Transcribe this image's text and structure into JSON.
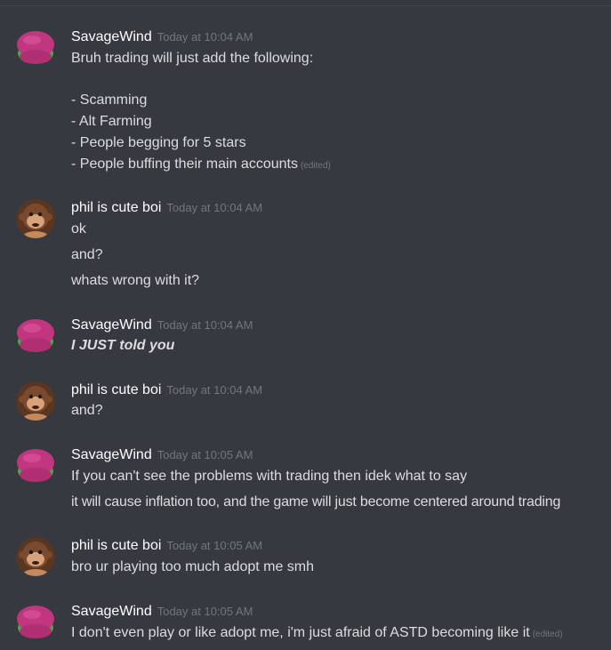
{
  "messages": [
    {
      "author": "SavageWind",
      "time": "Today at 10:04 AM",
      "lines": [
        "Bruh trading will just add the following:",
        "- Scamming",
        "- Alt Farming",
        "- People begging for 5 stars",
        "- People buffing their main accounts"
      ],
      "edited_label": "(edited)"
    },
    {
      "author": "phil is cute boi",
      "time": "Today at 10:04 AM",
      "lines": [
        "ok",
        "and?",
        "whats wrong with it?"
      ]
    },
    {
      "author": "SavageWind",
      "time": "Today at 10:04 AM",
      "lines": [
        "I JUST told you"
      ]
    },
    {
      "author": "phil is cute boi",
      "time": "Today at 10:04 AM",
      "lines": [
        "and?"
      ]
    },
    {
      "author": "SavageWind",
      "time": "Today at 10:05 AM",
      "lines": [
        "If you can't see the problems with trading then idek what to say",
        "it will cause inflation too, and the game will just become centered around trading"
      ]
    },
    {
      "author": "phil is cute boi",
      "time": "Today at 10:05 AM",
      "lines": [
        "bro ur playing too much adopt me smh"
      ]
    },
    {
      "author": "SavageWind",
      "time": "Today at 10:05 AM",
      "lines": [
        "I don't even play or like adopt me, i'm just afraid of ASTD becoming like it"
      ],
      "edited_label": "(edited)"
    }
  ],
  "colors": {
    "background": "#36393f",
    "username": "#ffffff",
    "timestamp": "#72767d",
    "message_text": "#dcddde",
    "savagewind_avatar": "#c2357f",
    "phil_avatar": "#7a4a2e"
  }
}
